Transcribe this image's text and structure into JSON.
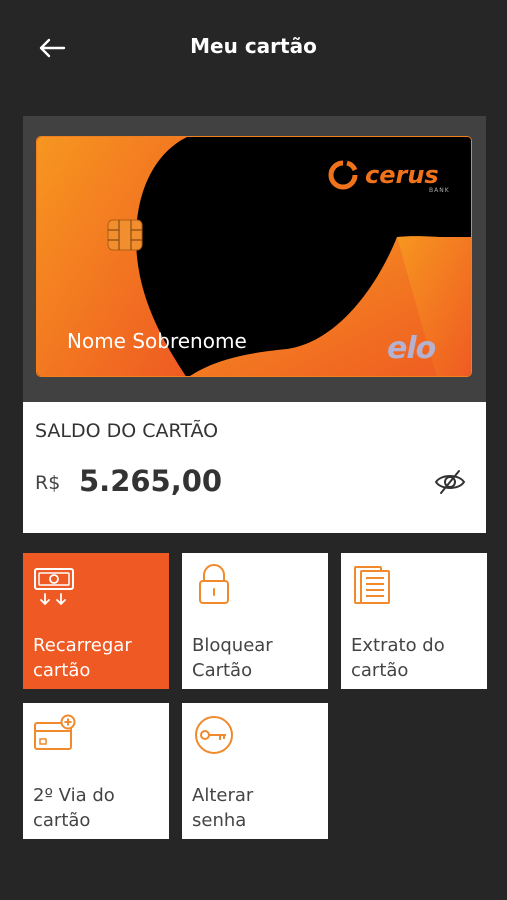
{
  "header": {
    "title": "Meu cartão",
    "back_icon": "arrow-left-icon"
  },
  "card": {
    "brand": "cerus",
    "brand_sub": "BANK",
    "holder_name": "Nome Sobrenome",
    "network": "elo",
    "colors": {
      "accent": "#f0801f",
      "background": "#000000"
    }
  },
  "balance": {
    "label": "SALDO DO CARTÃO",
    "currency": "R$",
    "amount": "5.265,00",
    "visibility_icon": "eye-off-icon"
  },
  "actions": [
    {
      "label_line1": "Recarregar",
      "label_line2": "cartão",
      "icon": "money-recharge-icon",
      "active": true
    },
    {
      "label_line1": "Bloquear",
      "label_line2": "Cartão",
      "icon": "lock-icon",
      "active": false
    },
    {
      "label_line1": "Extrato do",
      "label_line2": "cartão",
      "icon": "statement-icon",
      "active": false
    },
    {
      "label_line1": "2º Via do",
      "label_line2": "cartão",
      "icon": "card-add-icon",
      "active": false
    },
    {
      "label_line1": "Alterar",
      "label_line2": "senha",
      "icon": "key-icon",
      "active": false
    }
  ],
  "colors": {
    "page_bg": "#262626",
    "primary": "#ef5a24",
    "icon_orange": "#f08a2c"
  }
}
